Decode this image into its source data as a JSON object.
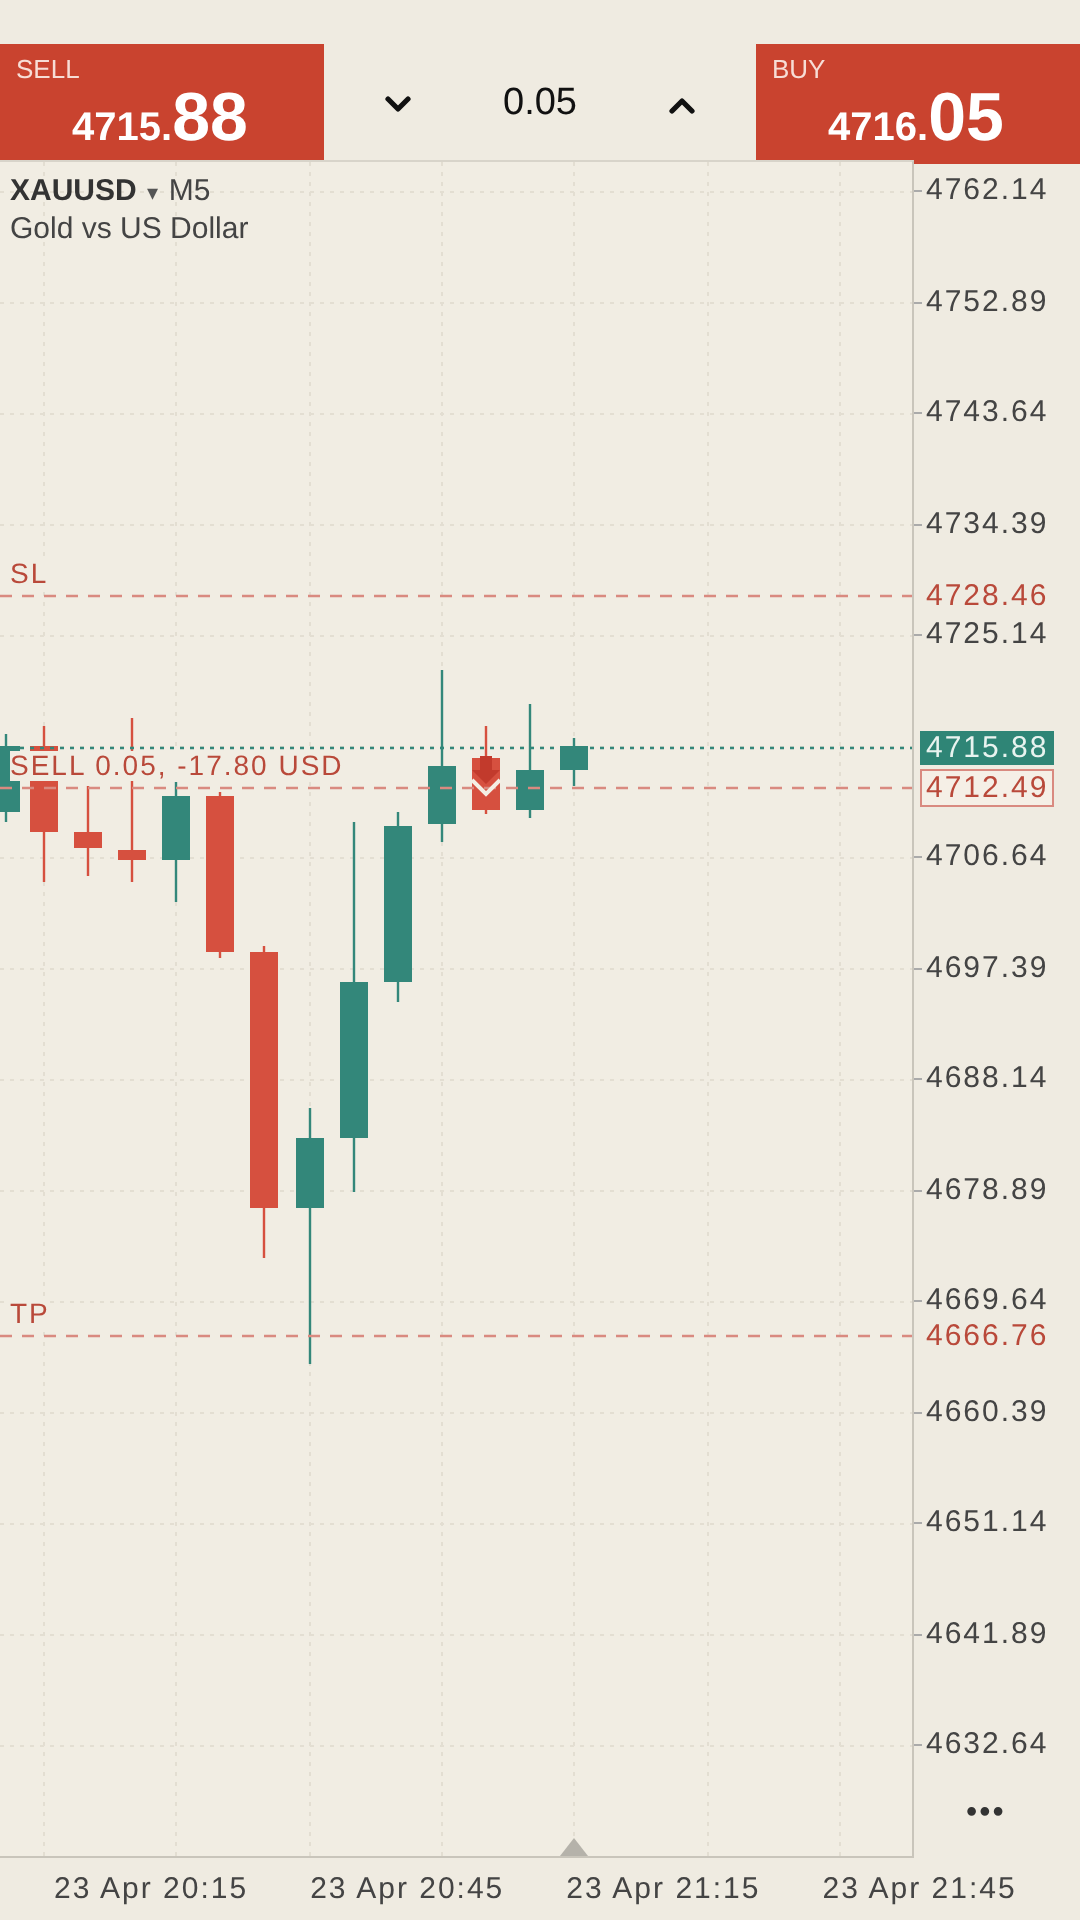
{
  "trade_panel": {
    "sell": {
      "label": "SELL",
      "price_prefix": "4715.",
      "price_digits": "88"
    },
    "volume": {
      "value": "0.05"
    },
    "buy": {
      "label": "BUY",
      "price_prefix": "4716.",
      "price_digits": "05"
    }
  },
  "chart": {
    "symbol": "XAUUSD",
    "symbol_menu": "▾",
    "timeframe": "M5",
    "description": "Gold vs US Dollar",
    "price_axis": [
      "4762.14",
      "4752.89",
      "4743.64",
      "4734.39",
      "4725.14",
      "4706.64",
      "4697.39",
      "4688.14",
      "4678.89",
      "4669.64",
      "4660.39",
      "4651.14",
      "4641.89",
      "4632.64"
    ],
    "levels": [
      {
        "kind": "sl",
        "label": "SL",
        "price": "4728.46"
      },
      {
        "kind": "bid",
        "price": "4715.88"
      },
      {
        "kind": "position",
        "label": "SELL 0.05, -17.80 USD",
        "price": "4712.49"
      },
      {
        "kind": "tp",
        "label": "TP",
        "price": "4666.76"
      }
    ],
    "time_axis": [
      "23 Apr 20:15",
      "23 Apr 20:45",
      "23 Apr 21:15",
      "23 Apr 21:45"
    ],
    "more_menu": "•••"
  }
}
